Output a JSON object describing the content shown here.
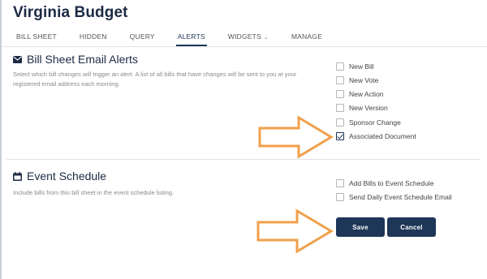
{
  "app": {
    "title": "Virginia Budget"
  },
  "tabs": [
    {
      "label": "BILL SHEET"
    },
    {
      "label": "HIDDEN"
    },
    {
      "label": "QUERY"
    },
    {
      "label": "ALERTS",
      "active": true
    },
    {
      "label": "WIDGETS",
      "dropdown": true
    },
    {
      "label": "MANAGE"
    }
  ],
  "alerts_section": {
    "icon": "envelope-icon",
    "title": "Bill Sheet Email Alerts",
    "description": "Select which bill changes will trigger an alert. A list of all bills that have changes will be sent to you at your registered email address each morning.",
    "options": [
      {
        "label": "New Bill",
        "checked": false
      },
      {
        "label": "New Vote",
        "checked": false
      },
      {
        "label": "New Action",
        "checked": false
      },
      {
        "label": "New Version",
        "checked": false
      },
      {
        "label": "Sponsor Change",
        "checked": false
      },
      {
        "label": "Associated Document",
        "checked": true
      }
    ]
  },
  "event_section": {
    "icon": "calendar-icon",
    "title": "Event Schedule",
    "description": "Include bills from this bill sheet in the event schedule listing.",
    "options": [
      {
        "label": "Add Bills to Event Schedule",
        "checked": false
      },
      {
        "label": "Send Daily Event Schedule Email",
        "checked": false
      }
    ]
  },
  "buttons": {
    "save": "Save",
    "cancel": "Cancel"
  },
  "colors": {
    "brand": "#1e3657",
    "arrow": "#f0a04b"
  }
}
